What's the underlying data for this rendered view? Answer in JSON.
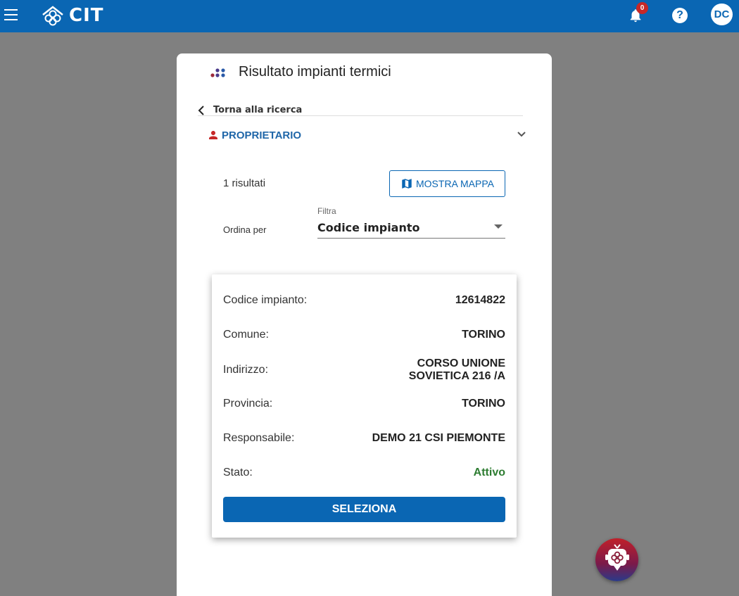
{
  "header": {
    "logo_text": "CIT",
    "notification_count": "0",
    "help_symbol": "?",
    "user_initials": "DC",
    "brand_color": "#0a66b3"
  },
  "page": {
    "title": "Risultato impianti termici",
    "back_label": "Torna alla ricerca",
    "accordion_label": "PROPRIETARIO"
  },
  "results": {
    "count_label": "1 risultati",
    "map_button_label": "MOSTRA MAPPA",
    "sort_label": "Ordina per",
    "filter_label": "Filtra",
    "filter_value": "Codice impianto"
  },
  "result_card": {
    "rows": [
      {
        "label": "Codice impianto:",
        "value": "12614822"
      },
      {
        "label": "Comune:",
        "value": "TORINO"
      },
      {
        "label": "Indirizzo:",
        "value": "CORSO UNIONE SOVIETICA 216 /A"
      },
      {
        "label": "Provincia:",
        "value": "TORINO"
      },
      {
        "label": "Responsabile:",
        "value": "DEMO 21 CSI PIEMONTE"
      },
      {
        "label": "Stato:",
        "value": "Attivo"
      }
    ],
    "select_button_label": "SELEZIONA",
    "status_color": "#2e7d32"
  },
  "icons": {
    "menu": "hamburger-menu-icon",
    "bell": "bell-icon",
    "help": "help-icon",
    "back": "chevron-left-icon",
    "person": "person-icon",
    "expand": "chevron-down-icon",
    "map": "map-icon",
    "chatbot": "chatbot-icon"
  }
}
